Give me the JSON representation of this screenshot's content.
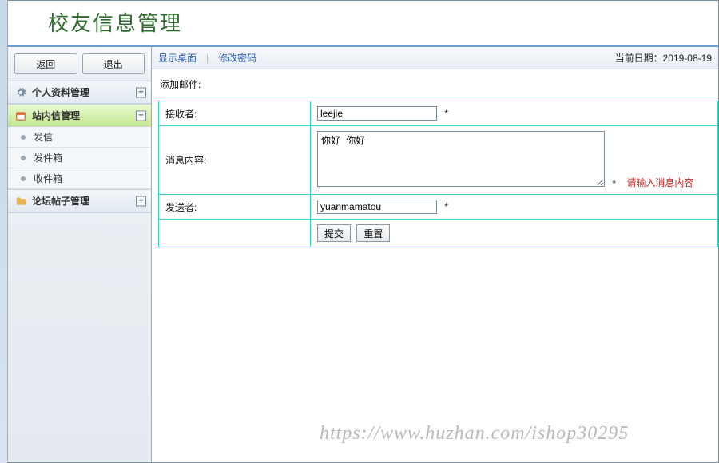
{
  "header": {
    "title": "校友信息管理"
  },
  "sidebar": {
    "back_label": "返回",
    "exit_label": "退出",
    "sections": {
      "personal": {
        "title": "个人资料管理",
        "toggle": "+"
      },
      "mail": {
        "title": "站内信管理",
        "toggle": "−",
        "items": [
          "发信",
          "发件箱",
          "收件箱"
        ]
      },
      "forum": {
        "title": "论坛帖子管理",
        "toggle": "+"
      }
    }
  },
  "topbar": {
    "show_desktop": "显示桌面",
    "change_password": "修改密码",
    "date_label": "当前日期：",
    "date_value": "2019-08-19"
  },
  "form": {
    "section": "添加邮件:",
    "recipient_label": "接收者:",
    "recipient_value": "leejie",
    "content_label": "消息内容:",
    "content_value": "你好 你好",
    "content_error": "请输入消息内容",
    "sender_label": "发送者:",
    "sender_value": "yuanmamatou",
    "required_mark": "*",
    "submit": "提交",
    "reset": "重置"
  },
  "watermark": "https://www.huzhan.com/ishop30295"
}
